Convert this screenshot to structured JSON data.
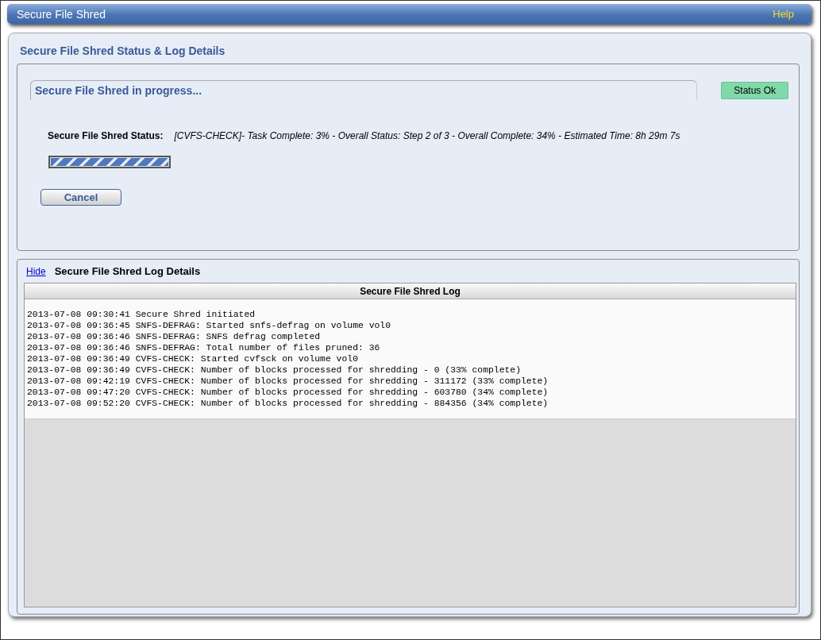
{
  "window": {
    "title": "Secure File Shred",
    "help": "Help"
  },
  "status_panel": {
    "title": "Secure File Shred Status & Log Details",
    "progress_heading": "Secure File Shred in progress...",
    "status_badge": "Status Ok",
    "status_label": "Secure File Shred Status:",
    "status_text": "[CVFS-CHECK]- Task Complete: 3% - Overall Status: Step 2 of 3 - Overall Complete: 34% - Estimated Time: 8h 29m 7s",
    "progress": {
      "level": 1
    },
    "cancel_button": "Cancel"
  },
  "log_panel": {
    "hide_link": "Hide",
    "title": "Secure File Shred Log Details",
    "log_header": "Secure File Shred Log",
    "lines": [
      "2013-07-08 09:30:41 Secure Shred initiated",
      "2013-07-08 09:36:45 SNFS-DEFRAG: Started snfs-defrag on volume vol0",
      "2013-07-08 09:36:46 SNFS-DEFRAG: SNFS defrag completed",
      "2013-07-08 09:36:46 SNFS-DEFRAG: Total number of files pruned: 36",
      "2013-07-08 09:36:49 CVFS-CHECK: Started cvfsck on volume vol0",
      "2013-07-08 09:36:49 CVFS-CHECK: Number of blocks processed for shredding - 0 (33% complete)",
      "2013-07-08 09:42:19 CVFS-CHECK: Number of blocks processed for shredding - 311172 (33% complete)",
      "2013-07-08 09:47:20 CVFS-CHECK: Number of blocks processed for shredding - 603780 (34% complete)",
      "2013-07-08 09:52:20 CVFS-CHECK: Number of blocks processed for shredding - 884356 (34% complete)"
    ]
  }
}
